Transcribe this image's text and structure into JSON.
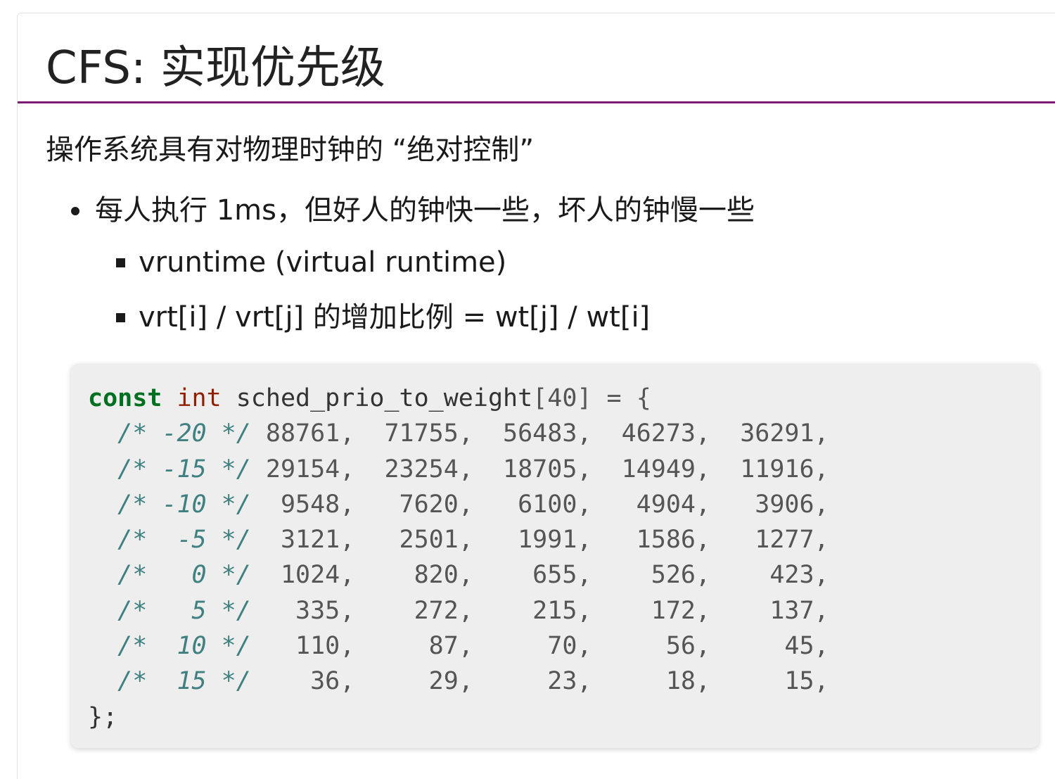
{
  "slide": {
    "title": "CFS: 实现优先级",
    "intro": "操作系统具有对物理时钟的 “绝对控制”",
    "bullets": [
      {
        "text": "每人执行 1ms，但好人的钟快一些，坏人的钟慢一些",
        "sub": [
          "vruntime (virtual runtime)",
          "vrt[i] / vrt[j] 的增加比例 = wt[j] / wt[i]"
        ]
      }
    ],
    "code": {
      "language": "c",
      "keyword_const": "const",
      "keyword_int": "int",
      "decl": " sched_prio_to_weight",
      "open_bracket": "[",
      "size": "40",
      "close_and_assign": "] = {",
      "rows": [
        {
          "comment": "/* -20 */",
          "values": "88761,  71755,  56483,  46273,  36291,"
        },
        {
          "comment": "/* -15 */",
          "values": "29154,  23254,  18705,  14949,  11916,"
        },
        {
          "comment": "/* -10 */",
          "values": " 9548,   7620,   6100,   4904,   3906,"
        },
        {
          "comment": "/*  -5 */",
          "values": " 3121,   2501,   1991,   1586,   1277,"
        },
        {
          "comment": "/*   0 */",
          "values": " 1024,    820,    655,    526,    423,"
        },
        {
          "comment": "/*   5 */",
          "values": "  335,    272,    215,    172,    137,"
        },
        {
          "comment": "/*  10 */",
          "values": "  110,     87,     70,     56,     45,"
        },
        {
          "comment": "/*  15 */",
          "values": "   36,     29,     23,     18,     15,"
        }
      ],
      "closing": "};"
    }
  },
  "colors": {
    "title_rule": "#7b1c72",
    "code_background": "#eeeeee",
    "keyword_const": "#007020",
    "keyword_int": "#902000",
    "comment": "#408080"
  }
}
